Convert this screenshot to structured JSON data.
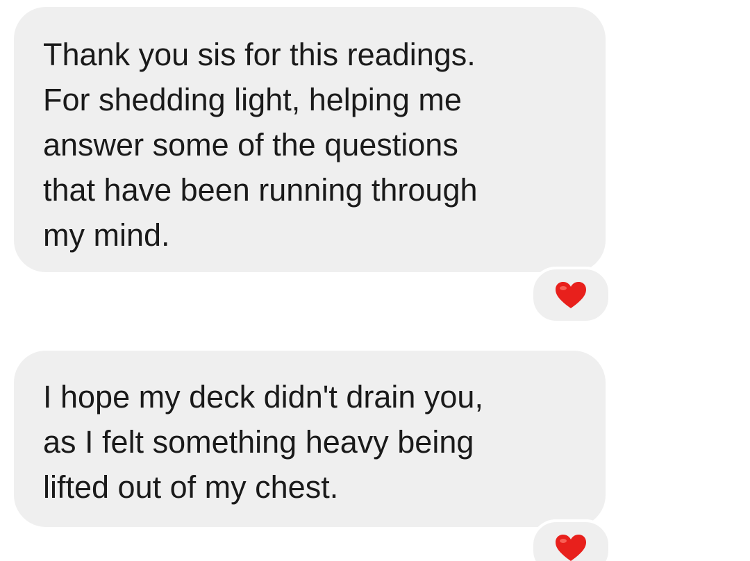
{
  "messages": [
    {
      "lines": [
        "Thank you sis for this readings.",
        "For shedding light, helping me",
        "answer some of the questions",
        "that have been running through",
        "my mind."
      ],
      "reaction": "heart-icon"
    },
    {
      "lines": [
        "I hope my deck didn't drain you,",
        "as I felt something heavy being",
        "lifted out of my chest."
      ],
      "reaction": "heart-icon"
    }
  ],
  "colors": {
    "bubble": "#efefef",
    "text": "#1a1a1a",
    "heart": "#e8201c",
    "background": "#ffffff"
  }
}
